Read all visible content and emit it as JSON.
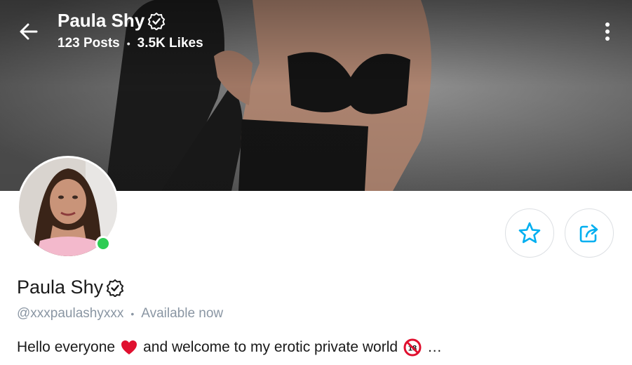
{
  "header": {
    "title": "Paula Shy",
    "posts": "123 Posts",
    "separator": "•",
    "likes": "3.5K Likes"
  },
  "icons": {
    "back": "arrow-left-icon",
    "verified": "verified-badge-icon",
    "more": "more-vertical-icon",
    "star": "star-icon",
    "share": "share-icon",
    "heart": "heart-emoji-icon",
    "no18": "no-under-18-emoji-icon"
  },
  "profile": {
    "name": "Paula Shy",
    "handle": "@xxxpaulashyxxx",
    "separator": "•",
    "status": "Available now",
    "bio_part1": "Hello everyone",
    "bio_part2": "and welcome to my erotic private world",
    "bio_ellipsis": "…",
    "no18_label": "18"
  },
  "colors": {
    "accent": "#00aff0",
    "online": "#2ecc54",
    "muted_text": "#8a96a3",
    "heart": "#e0102f"
  }
}
